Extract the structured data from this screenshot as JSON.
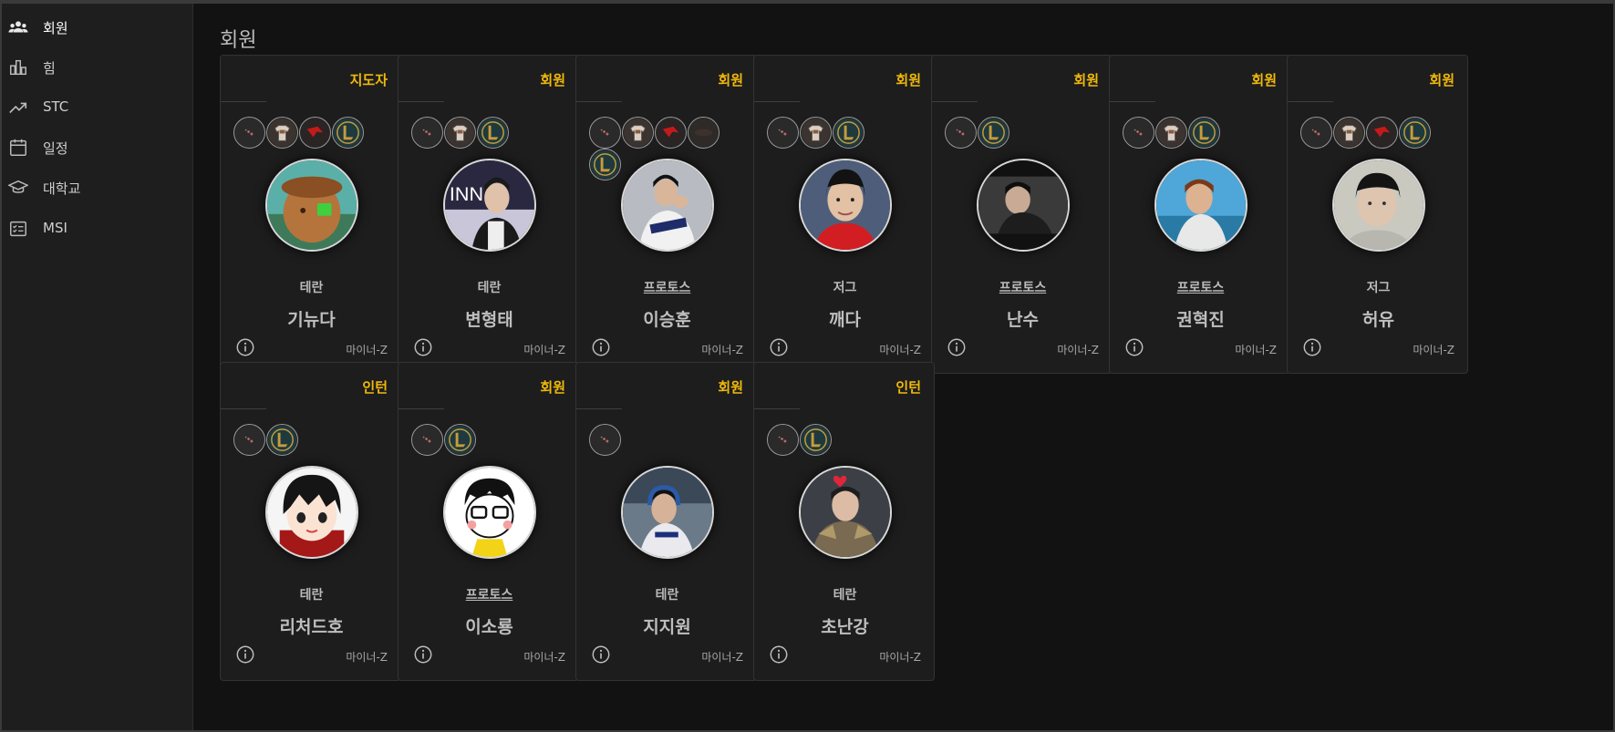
{
  "sidebar": {
    "items": [
      {
        "label": "회원",
        "icon": "members-icon",
        "active": true
      },
      {
        "label": "힘",
        "icon": "bar-chart-icon",
        "active": false
      },
      {
        "label": "STC",
        "icon": "trending-up-icon",
        "active": false
      },
      {
        "label": "일정",
        "icon": "calendar-icon",
        "active": false
      },
      {
        "label": "대학교",
        "icon": "graduation-cap-icon",
        "active": false
      },
      {
        "label": "MSI",
        "icon": "checklist-icon",
        "active": false
      }
    ]
  },
  "main": {
    "title": "회원",
    "members": [
      {
        "role": "지도자",
        "race": "테란",
        "race_link": false,
        "name": "기뉴다",
        "mod": "마이너-Z",
        "badges": [
          "starcraft-icon",
          "trophy-jersey-icon",
          "red-flag-icon",
          "league-icon"
        ],
        "avatar": "cartoon"
      },
      {
        "role": "회원",
        "race": "테란",
        "race_link": false,
        "name": "변형태",
        "mod": "마이너-Z",
        "badges": [
          "starcraft-icon",
          "trophy-jersey-icon",
          "league-icon"
        ],
        "avatar": "photo-stage"
      },
      {
        "role": "회원",
        "race": "프로토스",
        "race_link": true,
        "name": "이승훈",
        "mod": "마이너-Z",
        "badges": [
          "starcraft-icon",
          "trophy-jersey-icon",
          "red-flag-icon",
          "dark-badge-icon",
          "league-icon"
        ],
        "avatar": "photo-white"
      },
      {
        "role": "회원",
        "race": "저그",
        "race_link": false,
        "name": "깨다",
        "mod": "마이너-Z",
        "badges": [
          "starcraft-icon",
          "trophy-jersey-icon",
          "league-icon"
        ],
        "avatar": "photo-red"
      },
      {
        "role": "회원",
        "race": "프로토스",
        "race_link": true,
        "name": "난수",
        "mod": "마이너-Z",
        "badges": [
          "starcraft-icon",
          "league-icon"
        ],
        "avatar": "photo-dark"
      },
      {
        "role": "회원",
        "race": "프로토스",
        "race_link": true,
        "name": "권혁진",
        "mod": "마이너-Z",
        "badges": [
          "starcraft-icon",
          "trophy-jersey-icon",
          "league-icon"
        ],
        "avatar": "photo-blue"
      },
      {
        "role": "회원",
        "race": "저그",
        "race_link": false,
        "name": "허유",
        "mod": "마이너-Z",
        "badges": [
          "starcraft-icon",
          "trophy-jersey-icon",
          "red-flag-icon",
          "league-icon"
        ],
        "avatar": "photo-pale"
      },
      {
        "role": "인턴",
        "race": "테란",
        "race_link": false,
        "name": "리처드호",
        "mod": "마이너-Z",
        "badges": [
          "starcraft-icon",
          "league-icon"
        ],
        "avatar": "anime"
      },
      {
        "role": "회원",
        "race": "프로토스",
        "race_link": true,
        "name": "이소룡",
        "mod": "마이너-Z",
        "badges": [
          "starcraft-icon",
          "league-icon"
        ],
        "avatar": "cartoon-glasses"
      },
      {
        "role": "회원",
        "race": "테란",
        "race_link": false,
        "name": "지지원",
        "mod": "마이너-Z",
        "badges": [
          "starcraft-icon"
        ],
        "avatar": "photo-headset"
      },
      {
        "role": "인턴",
        "race": "테란",
        "race_link": false,
        "name": "초난강",
        "mod": "마이너-Z",
        "badges": [
          "starcraft-icon",
          "league-icon"
        ],
        "avatar": "photo-armor"
      }
    ]
  },
  "colors": {
    "role": "#f0b90b",
    "card_bg": "#1d1d1d",
    "page_bg": "#121212",
    "sidebar_bg": "#1e1e1e"
  }
}
